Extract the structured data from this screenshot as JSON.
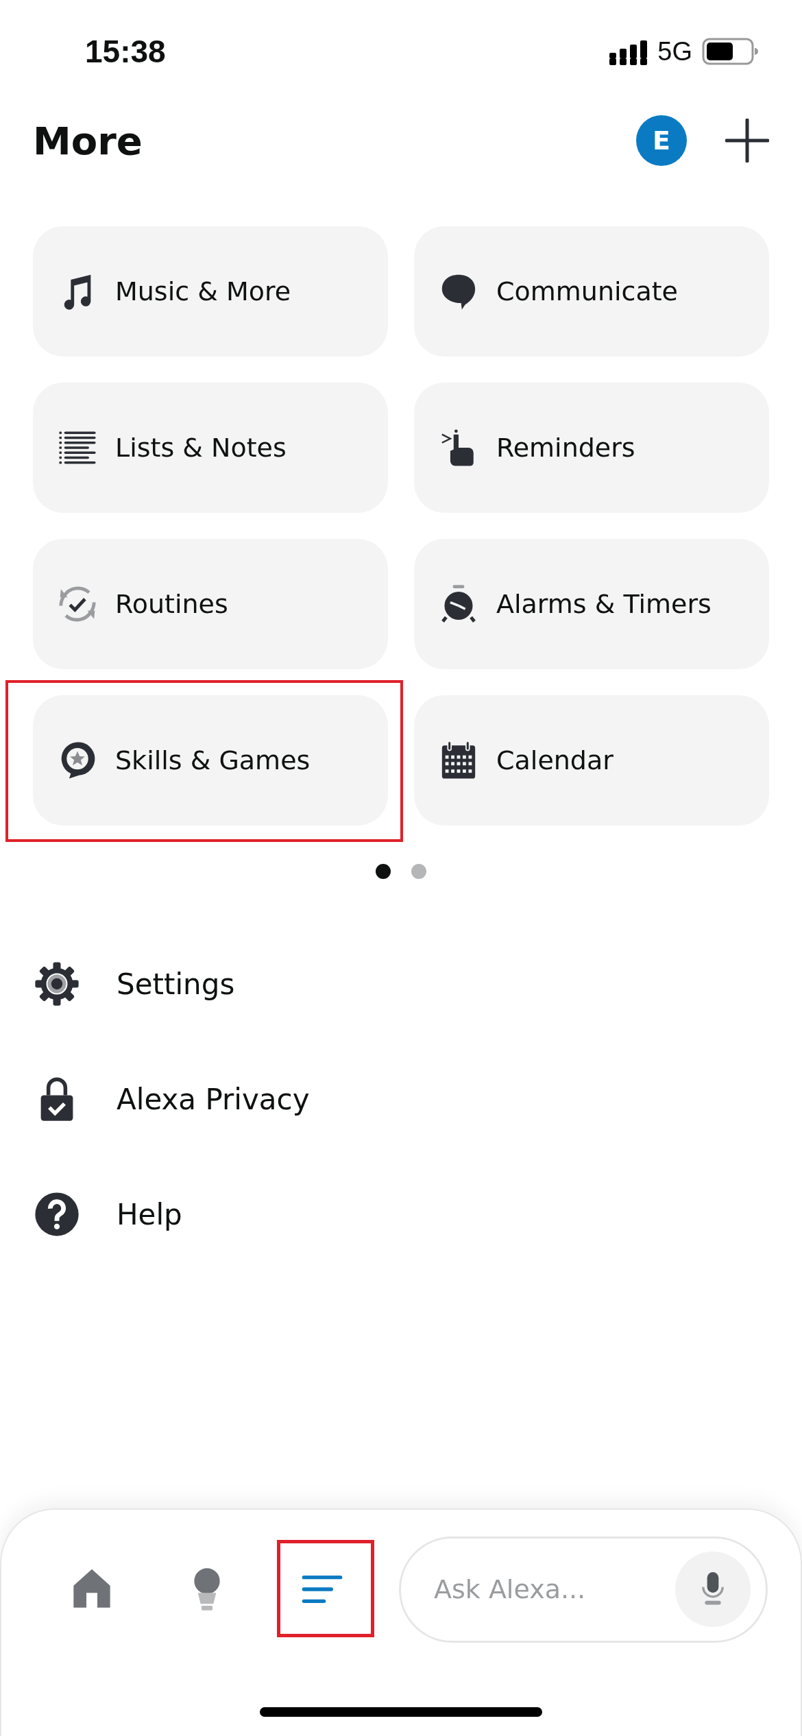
{
  "status_bar": {
    "time": "15:38",
    "network": "5G"
  },
  "header": {
    "title": "More",
    "avatar": "E"
  },
  "tiles": [
    {
      "label": "Music & More",
      "kind": "music",
      "highlighted": false
    },
    {
      "label": "Communicate",
      "kind": "bubble",
      "highlighted": false
    },
    {
      "label": "Lists & Notes",
      "kind": "list",
      "highlighted": false
    },
    {
      "label": "Reminders",
      "kind": "finger",
      "highlighted": false
    },
    {
      "label": "Routines",
      "kind": "routine",
      "highlighted": false
    },
    {
      "label": "Alarms & Timers",
      "kind": "alarm",
      "highlighted": false
    },
    {
      "label": "Skills & Games",
      "kind": "skills",
      "highlighted": true
    },
    {
      "label": "Calendar",
      "kind": "calendar",
      "highlighted": false
    }
  ],
  "page_dots": [
    {
      "selected": true
    },
    {
      "selected": false
    }
  ],
  "menu": [
    {
      "label": "Settings",
      "kind": "gear"
    },
    {
      "label": "Alexa Privacy",
      "kind": "lock"
    },
    {
      "label": "Help",
      "kind": "help"
    }
  ],
  "nav": [
    {
      "kind": "home",
      "selected": false,
      "highlighted": false
    },
    {
      "kind": "bulb",
      "selected": false,
      "highlighted": false
    },
    {
      "kind": "menu",
      "selected": true,
      "highlighted": true
    }
  ],
  "ask": {
    "placeholder": "Ask Alexa..."
  }
}
